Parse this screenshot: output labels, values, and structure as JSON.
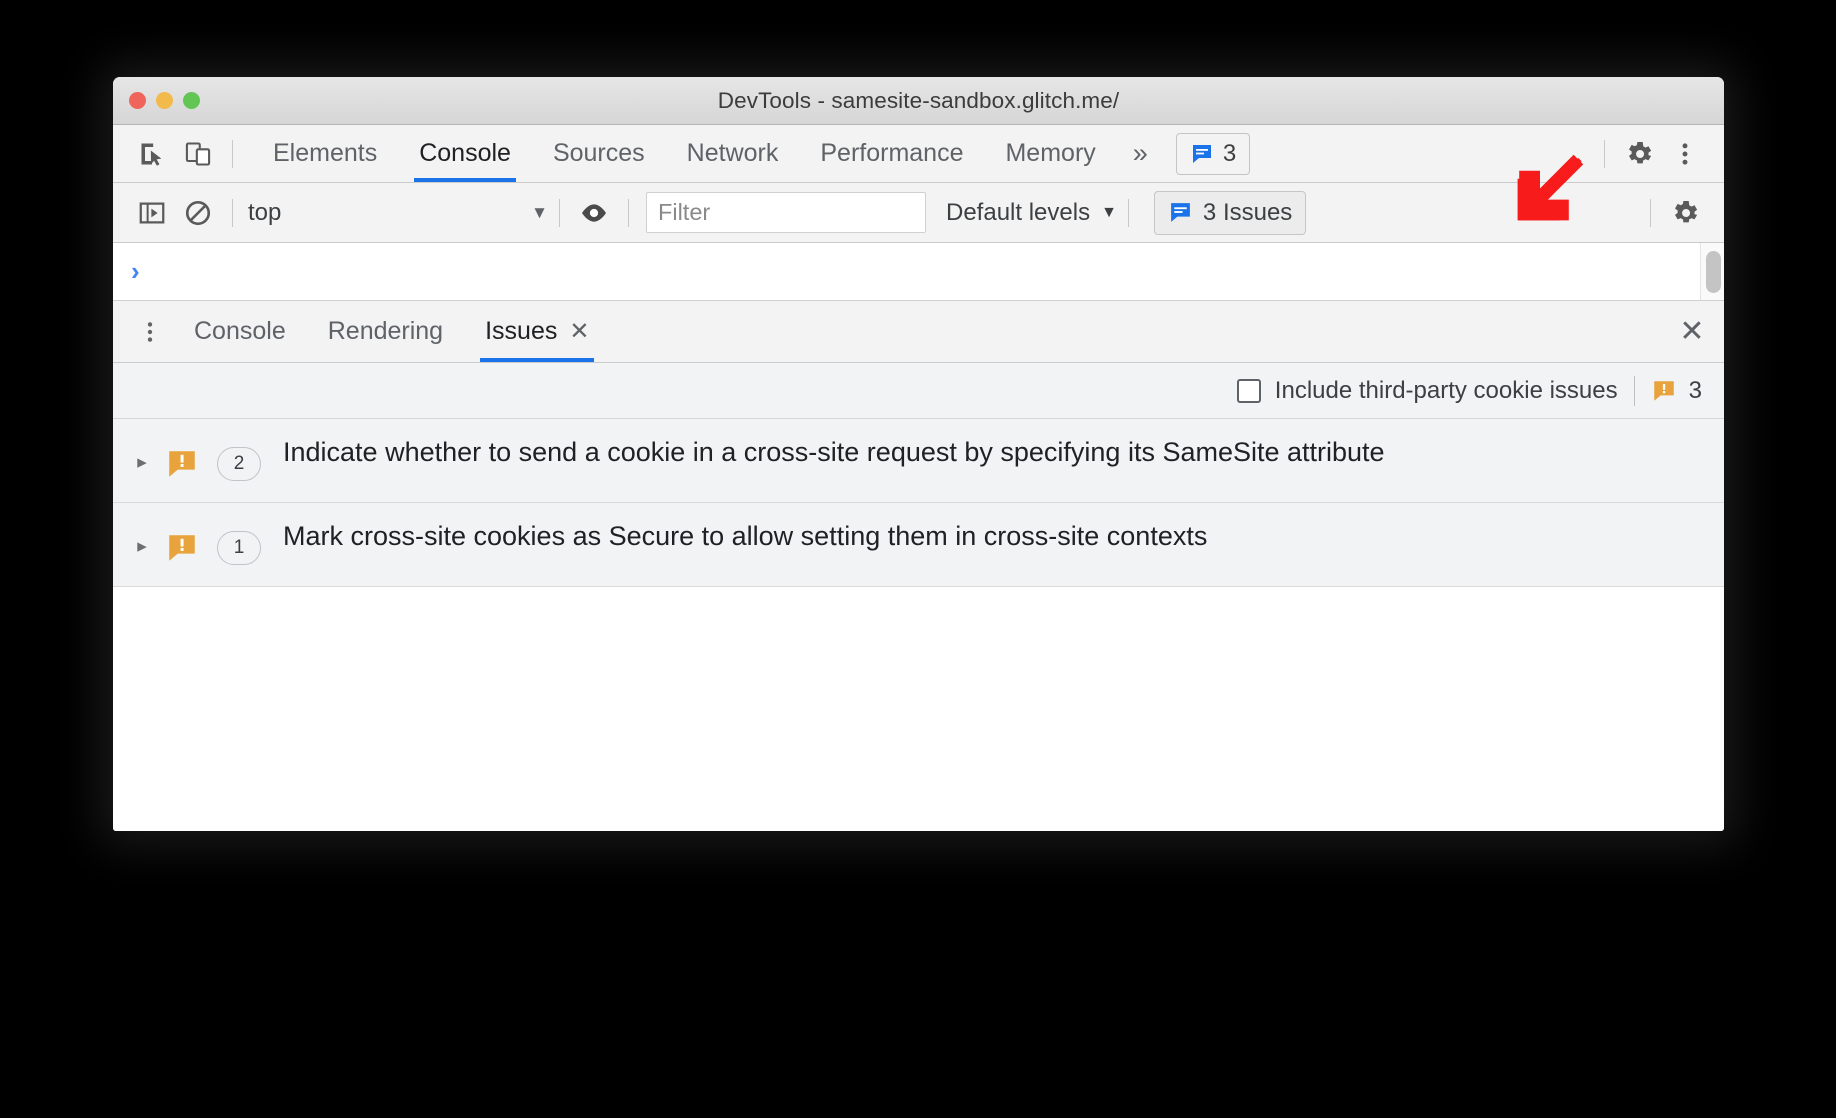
{
  "window": {
    "title": "DevTools - samesite-sandbox.glitch.me/",
    "traffic_lights": [
      "close",
      "minimize",
      "zoom"
    ]
  },
  "main_toolbar": {
    "inspect_icon": "inspect-element-icon",
    "device_icon": "device-toolbar-icon",
    "tabs": [
      {
        "label": "Elements",
        "selected": false
      },
      {
        "label": "Console",
        "selected": true
      },
      {
        "label": "Sources",
        "selected": false
      },
      {
        "label": "Network",
        "selected": false
      },
      {
        "label": "Performance",
        "selected": false
      },
      {
        "label": "Memory",
        "selected": false
      }
    ],
    "more_tabs_label": "»",
    "issues_badge": "3",
    "settings_icon": "gear-icon",
    "menu_icon": "more-vertical-icon"
  },
  "console_toolbar": {
    "sidebar_toggle_icon": "console-sidebar-icon",
    "clear_icon": "clear-console-icon",
    "context": "top",
    "context_caret": "▼",
    "eye_icon": "live-expression-icon",
    "filter_placeholder": "Filter",
    "filter_value": "",
    "levels_label": "Default levels",
    "levels_caret": "▼",
    "issues_chip_label": "3 Issues",
    "settings_icon": "gear-icon"
  },
  "console_prompt": {
    "prompt_symbol": "›",
    "value": ""
  },
  "drawer": {
    "kebab_icon": "more-vertical-icon",
    "tabs": [
      {
        "label": "Console",
        "selected": false,
        "closable": false
      },
      {
        "label": "Rendering",
        "selected": false,
        "closable": false
      },
      {
        "label": "Issues",
        "selected": true,
        "closable": true,
        "close_glyph": "✕"
      }
    ],
    "close_glyph": "✕"
  },
  "issues_pane": {
    "third_party_checkbox": {
      "label": "Include third-party cookie issues",
      "checked": false
    },
    "total_count": "3",
    "warning_icon": "warning-issue-icon",
    "rows": [
      {
        "expanded": false,
        "disclosure_glyph": "▸",
        "severity_icon": "warning-issue-icon",
        "count": "2",
        "title": "Indicate whether to send a cookie in a cross-site request by specifying its SameSite attribute"
      },
      {
        "expanded": false,
        "disclosure_glyph": "▸",
        "severity_icon": "warning-issue-icon",
        "count": "1",
        "title": "Mark cross-site cookies as Secure to allow setting them in cross-site contexts"
      }
    ]
  },
  "annotation": {
    "arrow_icon": "red-arrow-pointing-down-left",
    "color": "#f71b1b"
  },
  "colors": {
    "accent_blue": "#1a73e8",
    "issue_blue": "#1a73e8",
    "warning_orange": "#e8a33d",
    "annotation_red": "#f71b1b",
    "toolbar_bg": "#f3f3f3",
    "issues_bg": "#f1f3f4"
  }
}
